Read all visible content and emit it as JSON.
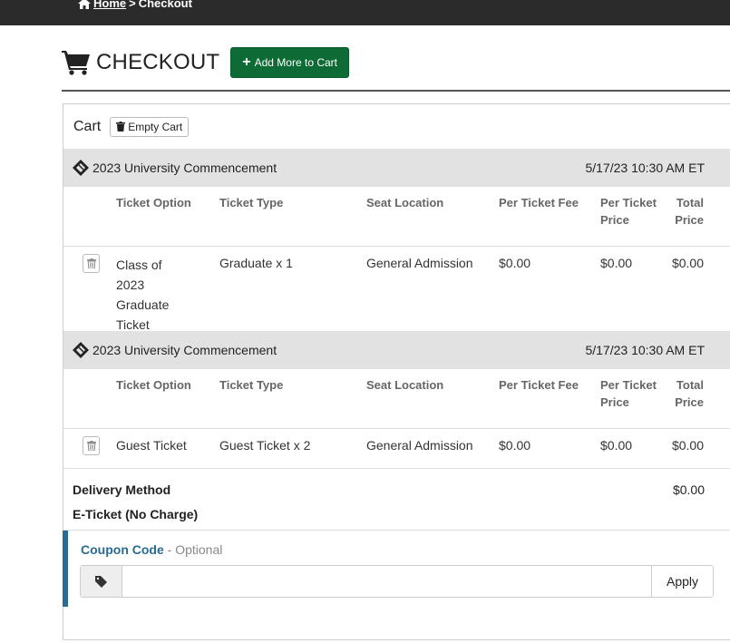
{
  "breadcrumb": {
    "home": "Home",
    "separator": ">",
    "current": "Checkout"
  },
  "page": {
    "title": "CHECKOUT",
    "add_button": "Add More to Cart"
  },
  "cart": {
    "label": "Cart",
    "empty_button": "Empty Cart"
  },
  "events": [
    {
      "name": "2023 University Commencement",
      "datetime": "5/17/23 10:30 AM ET",
      "columns": {
        "ticket_option": "Ticket Option",
        "ticket_type": "Ticket Type",
        "seat_location": "Seat Location",
        "per_ticket_fee": "Per Ticket Fee",
        "per_ticket_price": "Per Ticket Price",
        "total_price": "Total Price"
      },
      "row": {
        "ticket_option_lines": [
          "Class of",
          "2023",
          "Graduate",
          "Ticket"
        ],
        "ticket_type": "Graduate x 1",
        "seat_location": "General Admission",
        "per_ticket_fee": "$0.00",
        "per_ticket_price": "$0.00",
        "total_price": "$0.00"
      }
    },
    {
      "name": "2023 University Commencement",
      "datetime": "5/17/23 10:30 AM ET",
      "columns": {
        "ticket_option": "Ticket Option",
        "ticket_type": "Ticket Type",
        "seat_location": "Seat Location",
        "per_ticket_fee": "Per Ticket Fee",
        "per_ticket_price": "Per Ticket Price",
        "total_price": "Total Price"
      },
      "row": {
        "ticket_option": "Guest Ticket",
        "ticket_type": "Guest Ticket x 2",
        "seat_location": "General Admission",
        "per_ticket_fee": "$0.00",
        "per_ticket_price": "$0.00",
        "total_price": "$0.00"
      }
    }
  ],
  "delivery": {
    "label": "Delivery Method",
    "method": "E-Ticket (No Charge)",
    "amount": "$0.00"
  },
  "coupon": {
    "label": "Coupon Code",
    "optional": "- Optional",
    "value": "",
    "apply_button": "Apply"
  },
  "icons": [
    "home-icon",
    "shopping-cart-icon",
    "plus-icon",
    "trash-icon",
    "ticket-icon",
    "tag-icon"
  ],
  "colors": {
    "topbar": "#2b2b2b",
    "add_button": "#0f6b35",
    "event_bar": "#e2e2e2",
    "coupon_accent": "#2a6b90"
  }
}
